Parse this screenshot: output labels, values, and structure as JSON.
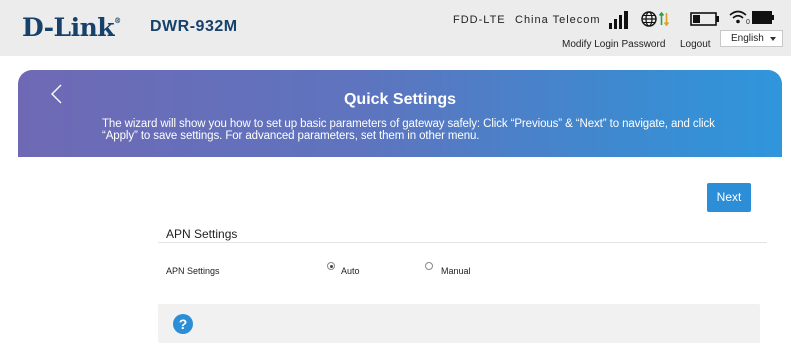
{
  "header": {
    "brand": "D-Link",
    "model": "DWR-932M",
    "network_type": "FDD-LTE",
    "carrier": "China Telecom",
    "clients_count": "0",
    "modify_password_label": "Modify Login Password",
    "logout_label": "Logout",
    "language": "English"
  },
  "icons": {
    "signal": "signal-strength-icon",
    "globe": "globe-icon",
    "data": "data-transfer-icon",
    "battery": "battery-icon",
    "wifi": "wifi-icon",
    "device": "device-icon",
    "back": "chevron-left-icon",
    "help": "help-icon"
  },
  "banner": {
    "title": "Quick Settings",
    "description": "The wizard will show you how to set up basic parameters of gateway safely: Click “Previous” & “Next” to navigate, and click “Apply” to save settings. For advanced parameters, set them in other menu."
  },
  "actions": {
    "next_label": "Next"
  },
  "apn": {
    "section_title": "APN Settings",
    "field_label": "APN Settings",
    "options": [
      "Auto",
      "Manual"
    ],
    "selected": "Auto"
  },
  "help": {
    "icon_text": "?"
  },
  "colors": {
    "brand": "#16416a",
    "accent": "#2b8ed6",
    "banner_start": "#6f69b5",
    "banner_end": "#2f96dc",
    "signal_green": "#2ca24a"
  }
}
